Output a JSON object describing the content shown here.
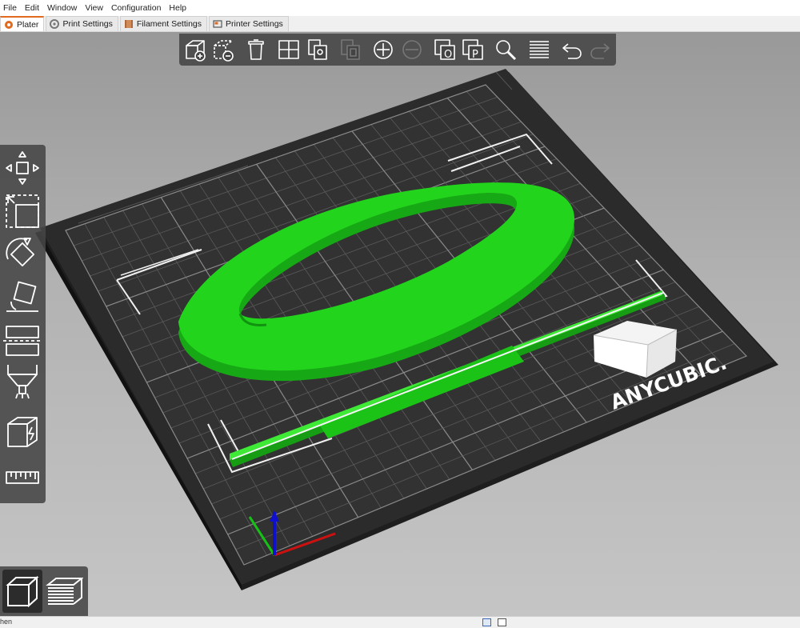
{
  "menu": [
    "File",
    "Edit",
    "Window",
    "View",
    "Configuration",
    "Help"
  ],
  "tabs": [
    {
      "label": "Plater",
      "icon": "plater-icon",
      "active": true
    },
    {
      "label": "Print Settings",
      "icon": "print-settings-icon",
      "active": false
    },
    {
      "label": "Filament Settings",
      "icon": "filament-spool-icon",
      "active": false
    },
    {
      "label": "Printer Settings",
      "icon": "printer-icon",
      "active": false
    }
  ],
  "top_toolbar": [
    {
      "icon": "add-object-icon",
      "enabled": true
    },
    {
      "icon": "delete-object-icon",
      "enabled": true
    },
    {
      "icon": "delete-all-icon",
      "enabled": true
    },
    {
      "icon": "arrange-icon",
      "enabled": true
    },
    {
      "icon": "copy-icon",
      "enabled": true
    },
    {
      "icon": "paste-icon",
      "enabled": false
    },
    {
      "icon": "add-instance-icon",
      "enabled": true
    },
    {
      "icon": "remove-instance-icon",
      "enabled": false
    },
    {
      "icon": "split-to-objects-icon",
      "enabled": true
    },
    {
      "icon": "split-to-parts-icon",
      "enabled": true
    },
    {
      "icon": "search-icon",
      "enabled": true
    },
    {
      "icon": "layers-editing-icon",
      "enabled": true
    },
    {
      "icon": "undo-icon",
      "enabled": true
    },
    {
      "icon": "redo-icon",
      "enabled": false
    }
  ],
  "left_toolbar": [
    "move-icon",
    "scale-icon",
    "rotate-icon",
    "place-on-face-icon",
    "cut-icon",
    "paint-supports-icon",
    "seam-painting-icon",
    "measure-icon"
  ],
  "view_toggle": [
    "3d-view-icon",
    "preview-icon"
  ],
  "bed": {
    "logo": "ANYCUBIC."
  },
  "colors": {
    "model": "#21d21a",
    "bed": "#2b2b2b",
    "accent": "#e06a1e"
  },
  "status": {
    "text": "hen"
  }
}
